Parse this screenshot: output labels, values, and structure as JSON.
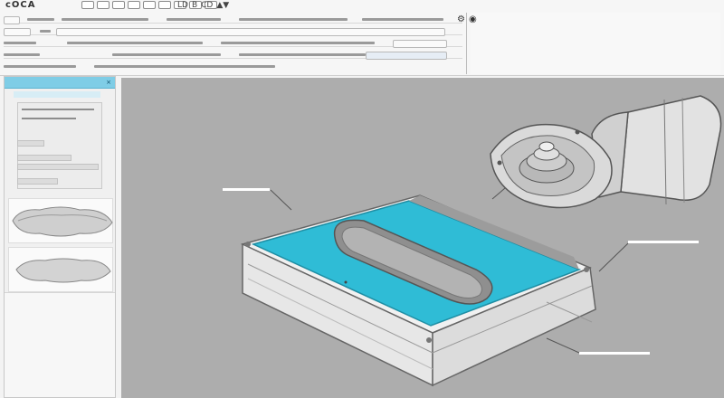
{
  "app": {
    "logo_text": "cOCA",
    "toolbar_mini_text": [
      "LD",
      "B",
      "CD",
      "▲▼"
    ]
  },
  "toolbar": {
    "icons": [
      "new-icon",
      "open-icon",
      "save-icon",
      "undo-icon",
      "redo-icon",
      "print-icon",
      "cut-icon",
      "copy-icon",
      "paste-icon"
    ]
  },
  "panel": {
    "title": "",
    "close_glyph": "×"
  },
  "viewport": {
    "background": "#adadad",
    "callout_count": 3
  },
  "colors": {
    "accent_panel": "#7fcde6",
    "mold_cavity": "#2fbcd6",
    "viewport_bg": "#adadad"
  }
}
